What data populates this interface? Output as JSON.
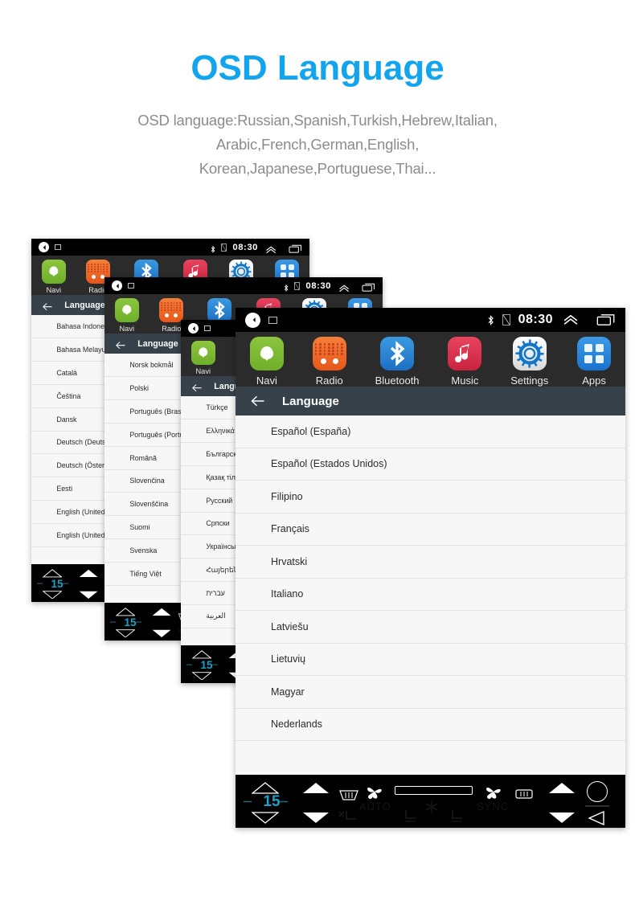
{
  "header": {
    "title": "OSD Language",
    "subtitle_lines": [
      "OSD language:Russian,Spanish,Turkish,Hebrew,Italian,",
      "Arabic,French,German,English,",
      "Korean,Japanese,Portuguese,Thai..."
    ],
    "title_color": "#12a5ee",
    "subtitle_color": "#8c8c8c"
  },
  "statusbar": {
    "speaker_icon": "volume-icon",
    "cast_icon": "screencast-icon",
    "bluetooth_icon": "bluetooth-icon",
    "sim_icon": "no-sim-icon",
    "time": "08:30",
    "chevron_icon": "chevron-up-icon",
    "recents_icon": "recent-apps-icon"
  },
  "dock": {
    "apps": [
      {
        "label": "Navi",
        "icon": "navi-icon",
        "color": "#7bb63a"
      },
      {
        "label": "Radio",
        "icon": "radio-icon",
        "color": "#ed6321"
      },
      {
        "label": "Bluetooth",
        "icon": "bluetooth-app-icon",
        "color": "#2a86d6"
      },
      {
        "label": "Music",
        "icon": "music-icon",
        "color": "#d62f4c"
      },
      {
        "label": "Settings",
        "icon": "settings-gear-icon",
        "color": "#ededed"
      },
      {
        "label": "Apps",
        "icon": "apps-grid-icon",
        "color": "#2a83dd"
      }
    ]
  },
  "pagebar": {
    "back_icon": "back-arrow-icon",
    "title": "Language"
  },
  "climate": {
    "temperature": "15",
    "temp_color": "#1ea0c8",
    "up_outline_icon": "temp-up-outline-icon",
    "down_outline_icon": "temp-down-outline-icon",
    "up_solid_icon": "fan-up-icon",
    "down_solid_icon": "fan-down-icon",
    "front_defrost_icon": "front-defrost-icon",
    "fan_left_icon": "fan-icon",
    "auto_label": "AUTO",
    "slider_icon": "temperature-slider",
    "snowflake_icon": "ac-snowflake-icon",
    "fan_right_icon": "fan-icon",
    "sync_label": "SYNC",
    "rear_defrost_icon": "rear-defrost-icon",
    "seat_heat_left_icon": "seat-heater-left-icon",
    "seat_heat_mid_icon": "seat-heater-mid-icon",
    "seat_heat_right_icon": "seat-heater-right-icon",
    "power_icon": "power-circle-icon",
    "back_icon": "back-triangle-icon"
  },
  "screens": [
    {
      "name": "screen-1-back",
      "languages": [
        "Bahasa Indonesia",
        "Bahasa Melayu",
        "Català",
        "Čeština",
        "Dansk",
        "Deutsch (Deutschland)",
        "Deutsch (Österreich)",
        "Eesti",
        "English (United Kingdom)",
        "English (United States)"
      ]
    },
    {
      "name": "screen-2",
      "languages": [
        "Norsk bokmål",
        "Polski",
        "Português (Brasil)",
        "Português (Portugal)",
        "Română",
        "Slovenčina",
        "Slovenščina",
        "Suomi",
        "Svenska",
        "Tiếng Việt"
      ]
    },
    {
      "name": "screen-3",
      "languages": [
        "Türkçe",
        "Ελληνικά",
        "Български",
        "Қазақ тілі",
        "Русский",
        "Српски",
        "Українська",
        "Հայերեն",
        "עברית",
        "العربية"
      ]
    },
    {
      "name": "screen-4-front",
      "languages": [
        "Español (España)",
        "Español (Estados Unidos)",
        "Filipino",
        "Français",
        "Hrvatski",
        "Italiano",
        "Latviešu",
        "Lietuvių",
        "Magyar",
        "Nederlands"
      ]
    }
  ]
}
